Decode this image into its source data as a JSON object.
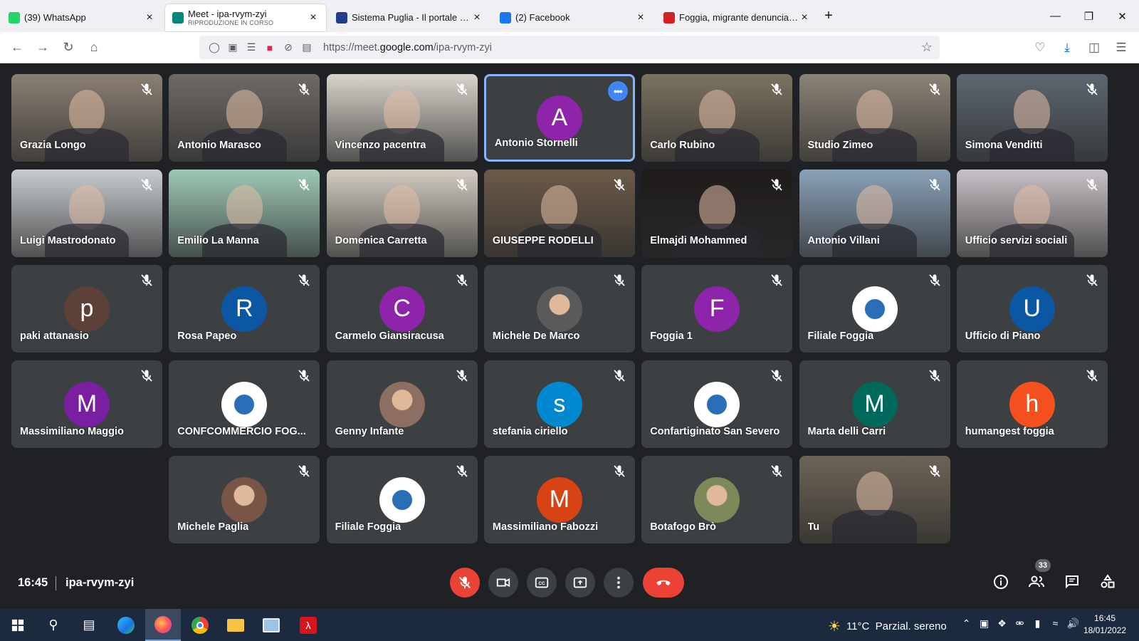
{
  "browser": {
    "tabs": [
      {
        "title": "(39) WhatsApp",
        "subtitle": "",
        "icon": "whatsapp-icon",
        "color": "#25d366"
      },
      {
        "title": "Meet - ipa-rvym-zyi",
        "subtitle": "RIPRODUZIONE IN CORSO",
        "icon": "meet-icon",
        "color": "#00897b"
      },
      {
        "title": "Sistema Puglia - Il portale dei s",
        "subtitle": "",
        "icon": "sistema-puglia-icon",
        "color": "#1f3d8a"
      },
      {
        "title": "(2) Facebook",
        "subtitle": "",
        "icon": "facebook-icon",
        "color": "#1877f2"
      },
      {
        "title": "Foggia, migrante denuncia viole",
        "subtitle": "",
        "icon": "news-icon",
        "color": "#d42020"
      }
    ],
    "url_prefix": "https://meet.",
    "url_domain": "google.com",
    "url_path": "/ipa-rvym-zyi"
  },
  "meet": {
    "time": "16:45",
    "code": "ipa-rvym-zyi",
    "participant_count": "33",
    "participants": [
      {
        "name": "Grazia Longo",
        "type": "video",
        "bg": "#8a7f72"
      },
      {
        "name": "Antonio Marasco",
        "type": "video",
        "bg": "#6e6a66"
      },
      {
        "name": "Vincenzo pacentra",
        "type": "video",
        "bg": "#d9d4cc"
      },
      {
        "name": "Antonio Stornelli",
        "type": "avatar",
        "letter": "A",
        "bg": "#8e24aa",
        "active": true
      },
      {
        "name": "Carlo Rubino",
        "type": "video",
        "bg": "#7b7260"
      },
      {
        "name": "Studio Zimeo",
        "type": "video",
        "bg": "#8c8377"
      },
      {
        "name": "Simona Venditti",
        "type": "video",
        "bg": "#5d6670"
      },
      {
        "name": "Luigi Mastrodonato",
        "type": "video",
        "bg": "#c9cdd0"
      },
      {
        "name": "Emilio La Manna",
        "type": "video",
        "bg": "#9ec9b6"
      },
      {
        "name": "Domenica Carretta",
        "type": "video",
        "bg": "#d3cdc2"
      },
      {
        "name": "GIUSEPPE RODELLI",
        "type": "video",
        "bg": "#6b5a48"
      },
      {
        "name": "Elmajdi Mohammed",
        "type": "video",
        "bg": "#1f1b1b"
      },
      {
        "name": "Antonio Villani",
        "type": "video",
        "bg": "#8aa2b8"
      },
      {
        "name": "Ufficio servizi sociali",
        "type": "video",
        "bg": "#c9c2c8"
      },
      {
        "name": "paki attanasio",
        "type": "avatar",
        "letter": "p",
        "bg": "#5d4037"
      },
      {
        "name": "Rosa Papeo",
        "type": "avatar",
        "letter": "R",
        "bg": "#0b57a4"
      },
      {
        "name": "Carmelo Giansiracusa",
        "type": "avatar",
        "letter": "C",
        "bg": "#8e24aa"
      },
      {
        "name": "Michele De Marco",
        "type": "photo",
        "bg": "#5a5a5a"
      },
      {
        "name": "Foggia 1",
        "type": "avatar",
        "letter": "F",
        "bg": "#8e24aa"
      },
      {
        "name": "Filiale Foggia",
        "type": "logo",
        "bg": "#ffffff"
      },
      {
        "name": "Ufficio di Piano",
        "type": "avatar",
        "letter": "U",
        "bg": "#0b57a4"
      },
      {
        "name": "Massimiliano Maggio",
        "type": "avatar",
        "letter": "M",
        "bg": "#7b1fa2"
      },
      {
        "name": "CONFCOMMERCIO FOG...",
        "type": "logo",
        "bg": "#ffffff"
      },
      {
        "name": "Genny Infante",
        "type": "photo",
        "bg": "#8d6e63"
      },
      {
        "name": "stefania ciriello",
        "type": "avatar",
        "letter": "s",
        "bg": "#0288d1"
      },
      {
        "name": "Confartiginato San Severo",
        "type": "logo",
        "bg": "#ffffff"
      },
      {
        "name": "Marta delli Carri",
        "type": "avatar",
        "letter": "M",
        "bg": "#00695c"
      },
      {
        "name": "humangest foggia",
        "type": "avatar",
        "letter": "h",
        "bg": "#f4511e"
      },
      {
        "name": "",
        "type": "blank"
      },
      {
        "name": "Michele Paglia",
        "type": "photo",
        "bg": "#795548"
      },
      {
        "name": "Filiale Foggia",
        "type": "logo",
        "bg": "#ffffff"
      },
      {
        "name": "Massimiliano Fabozzi",
        "type": "avatar",
        "letter": "M",
        "bg": "#d84315"
      },
      {
        "name": "Botafogo Brò",
        "type": "photo",
        "bg": "#7c8a5a"
      },
      {
        "name": "Tu",
        "type": "video",
        "bg": "#6d6456"
      }
    ]
  },
  "taskbar": {
    "weather": "11°C  Parzial. sereno",
    "time": "16:45",
    "date": "18/01/2022"
  }
}
